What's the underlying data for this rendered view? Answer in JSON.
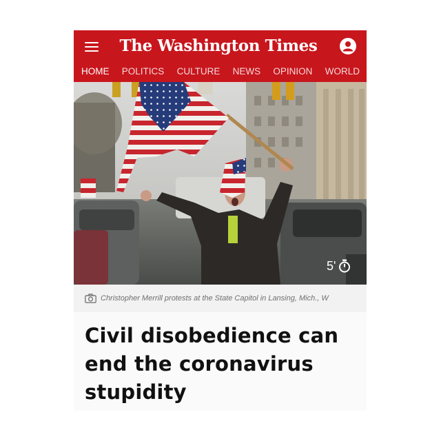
{
  "header": {
    "masthead": "The Washington Times",
    "menu_icon": "hamburger-menu-icon",
    "account_icon": "user-account-icon",
    "background_color": "#c8161d"
  },
  "nav": {
    "items": [
      {
        "label": "HOME",
        "active": true
      },
      {
        "label": "POLITICS",
        "active": false
      },
      {
        "label": "CULTURE",
        "active": false
      },
      {
        "label": "NEWS",
        "active": false
      },
      {
        "label": "OPINION",
        "active": false
      },
      {
        "label": "WORLD",
        "active": false
      }
    ]
  },
  "photo": {
    "duration": "5'",
    "duration_icon": "stopwatch-icon"
  },
  "caption": {
    "icon": "camera-icon",
    "text": "Christopher Merrill protests at the State Capitol in Lansing, Mich., W"
  },
  "article": {
    "headline": "Civil disobedience can end the coronavirus stupidity"
  }
}
